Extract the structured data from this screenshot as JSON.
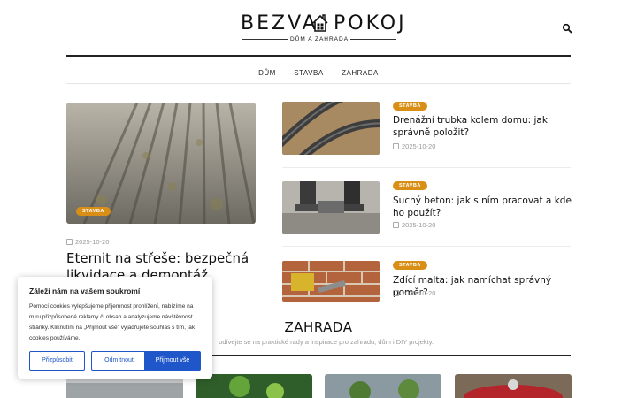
{
  "header": {
    "logo_left": "BEZVA",
    "logo_right": "POKOJ",
    "logo_tagline": "DŮM A ZAHRADA",
    "search_icon": "search-icon"
  },
  "nav": {
    "items": [
      {
        "label": "DŮM"
      },
      {
        "label": "STAVBA"
      },
      {
        "label": "ZAHRADA"
      }
    ]
  },
  "featured": {
    "badge": "STAVBA",
    "date": "2025-10-20",
    "title": "Eternit na střeše: bezpečná likvidace a demontáž"
  },
  "side_articles": [
    {
      "badge": "STAVBA",
      "title": "Drenážní trubka kolem domu: jak správně položit?",
      "date": "2025-10-20"
    },
    {
      "badge": "STAVBA",
      "title": "Suchý beton: jak s ním pracovat a kde ho použít?",
      "date": "2025-10-20"
    },
    {
      "badge": "STAVBA",
      "title": "Zdící malta: jak namíchat správný poměr?",
      "date": "2025-10-20"
    }
  ],
  "section": {
    "title": "ZAHRADA",
    "subtitle": "odívejte se na praktické rady a inspirace pro zahradu, dům i DIY projekty."
  },
  "cookie": {
    "title": "Záleží nám na vašem soukromí",
    "text": "Pomocí cookies vylepšujeme přijemnost prohlížení, nabízíme na míru přizpůsobené reklamy či obsah a analyzujeme návštěvnost stránky. Kliknutím na „Přijmout vše\" vyjadřujete souhlas s tím, jak cookies používáme.",
    "btn_customize": "Přizpůsobit",
    "btn_reject": "Odmítnout",
    "btn_accept": "Přijmout vše"
  },
  "colors": {
    "badge": "#d98f16",
    "cookie_button": "#1f56c9"
  }
}
